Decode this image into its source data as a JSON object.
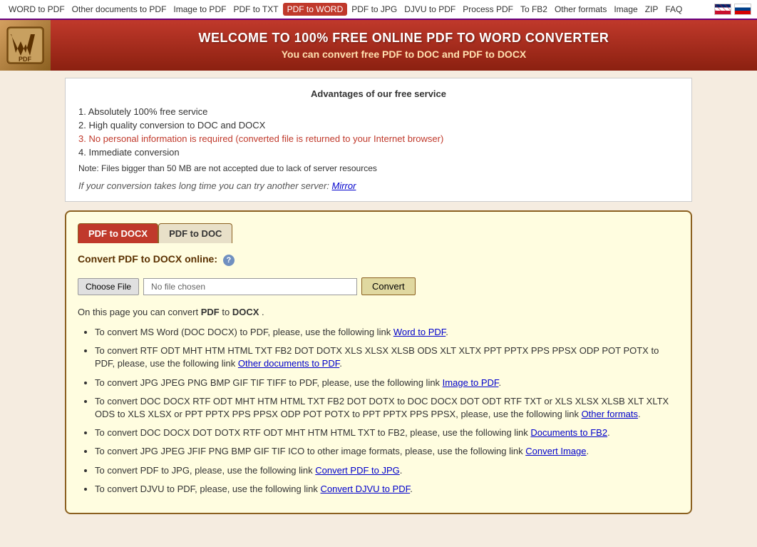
{
  "nav": {
    "links": [
      {
        "label": "WORD to PDF",
        "href": "#",
        "active": false
      },
      {
        "label": "Other documents to PDF",
        "href": "#",
        "active": false
      },
      {
        "label": "Image to PDF",
        "href": "#",
        "active": false
      },
      {
        "label": "PDF to TXT",
        "href": "#",
        "active": false
      },
      {
        "label": "PDF to WORD",
        "href": "#",
        "active": true
      },
      {
        "label": "PDF to JPG",
        "href": "#",
        "active": false
      },
      {
        "label": "DJVU to PDF",
        "href": "#",
        "active": false
      },
      {
        "label": "Process PDF",
        "href": "#",
        "active": false
      },
      {
        "label": "To FB2",
        "href": "#",
        "active": false
      },
      {
        "label": "Other formats",
        "href": "#",
        "active": false
      },
      {
        "label": "Image",
        "href": "#",
        "active": false
      },
      {
        "label": "ZIP",
        "href": "#",
        "active": false
      },
      {
        "label": "FAQ",
        "href": "#",
        "active": false
      }
    ]
  },
  "header": {
    "logo_text": "W\nPDF",
    "title": "WELCOME TO 100% FREE ONLINE PDF TO WORD CONVERTER",
    "subtitle": "You can convert free PDF to DOC and PDF to DOCX"
  },
  "advantages": {
    "heading": "Advantages of our free service",
    "items": [
      "1. Absolutely 100% free service",
      "2. High quality conversion to DOC and DOCX",
      "3. No personal information is required (converted file is returned to your Internet browser)",
      "4. Immediate conversion"
    ],
    "note": "Note: Files bigger than 50 MB are not accepted due to lack of server resources",
    "mirror_text": "If your conversion takes long time you can try another server:",
    "mirror_link_label": "Mirror",
    "mirror_link_href": "#"
  },
  "tabs": [
    {
      "label": "PDF to DOCX",
      "active": true
    },
    {
      "label": "PDF to DOC",
      "active": false
    }
  ],
  "converter": {
    "title": "Convert PDF to DOCX online:",
    "choose_file_label": "Choose File",
    "file_placeholder": "No file chosen",
    "convert_button_label": "Convert"
  },
  "body": {
    "main_text": "On this page you can convert",
    "from_format": "PDF",
    "to_format": "DOCX",
    "period": ".",
    "bullets": [
      {
        "text": "To convert MS Word (DOC DOCX) to PDF, please, use the following link",
        "link_label": "Word to PDF",
        "link_href": "#",
        "suffix": "."
      },
      {
        "text": "To convert RTF ODT MHT HTM HTML TXT FB2 DOT DOTX XLS XLSX XLSB ODS XLT XLTX PPT PPTX PPS PPSX ODP POT POTX to PDF, please, use the following link",
        "link_label": "Other documents to PDF",
        "link_href": "#",
        "suffix": "."
      },
      {
        "text": "To convert JPG JPEG PNG BMP GIF TIF TIFF to PDF, please, use the following link",
        "link_label": "Image to PDF",
        "link_href": "#",
        "suffix": "."
      },
      {
        "text": "To convert DOC DOCX RTF ODT MHT HTM HTML TXT FB2 DOT DOTX to DOC DOCX DOT ODT RTF TXT or XLS XLSX XLSB XLT XLTX ODS to XLS XLSX or PPT PPTX PPS PPSX ODP POT POTX to PPT PPTX PPS PPSX, please, use the following link",
        "link_label": "Other formats",
        "link_href": "#",
        "suffix": "."
      },
      {
        "text": "To convert DOC DOCX DOT DOTX RTF ODT MHT HTM HTML TXT to FB2, please, use the following link",
        "link_label": "Documents to FB2",
        "link_href": "#",
        "suffix": "."
      },
      {
        "text": "To convert JPG JPEG JFIF PNG BMP GIF TIF ICO to other image formats, please, use the following link",
        "link_label": "Convert Image",
        "link_href": "#",
        "suffix": "."
      },
      {
        "text": "To convert PDF to JPG, please, use the following link",
        "link_label": "Convert PDF to JPG",
        "link_href": "#",
        "suffix": "."
      },
      {
        "text": "To convert DJVU to PDF, please, use the following link",
        "link_label": "Convert DJVU to PDF",
        "link_href": "#",
        "suffix": "."
      }
    ]
  }
}
